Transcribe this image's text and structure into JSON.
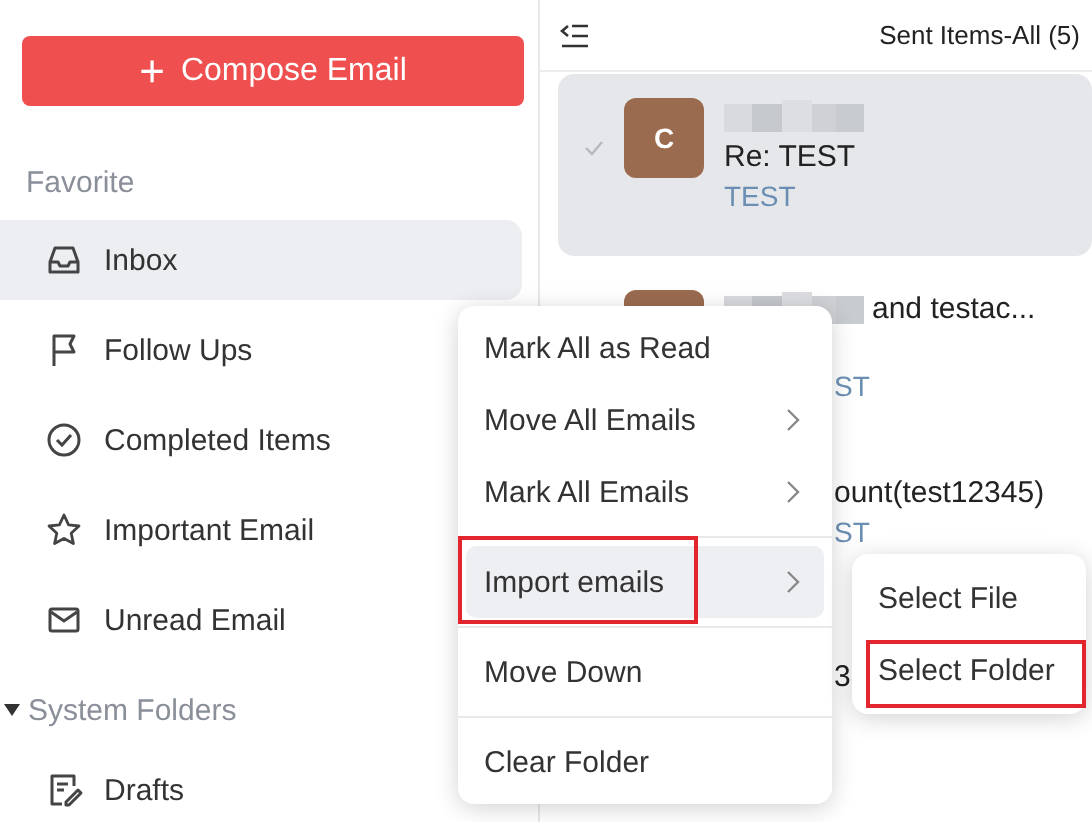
{
  "sidebar": {
    "compose_button": {
      "icon": "+",
      "label": "Compose Email"
    },
    "favorite_heading": "Favorite",
    "items": [
      {
        "label": "Inbox",
        "selected": true
      },
      {
        "label": "Follow Ups",
        "selected": false
      },
      {
        "label": "Completed Items",
        "selected": false
      },
      {
        "label": "Important Email",
        "selected": false
      },
      {
        "label": "Unread Email",
        "selected": false
      }
    ],
    "system_folders": {
      "label": "System Folders",
      "expanded": true,
      "items": [
        {
          "label": "Drafts",
          "selected": false
        }
      ]
    }
  },
  "mail_list": {
    "title": "Sent Items-All (5)",
    "mails": [
      {
        "kind": "full",
        "selected": true,
        "avatar_letter": "C",
        "name_blurred": true,
        "subject": "Re: TEST",
        "preview": "TEST"
      },
      {
        "kind": "partial",
        "selected": false,
        "name_blurred": true,
        "name": "and testac...",
        "preview": "ST"
      },
      {
        "kind": "covered",
        "selected": false,
        "name": "ount(test12345)",
        "preview": "ST"
      },
      {
        "kind": "edge",
        "selected": false,
        "name": "3"
      }
    ]
  },
  "context_menu": {
    "items": [
      {
        "label": "Mark All as Read",
        "submenu": false,
        "selected": false,
        "highlighted": false,
        "divider_before": false
      },
      {
        "label": "Move All Emails",
        "submenu": true,
        "selected": false,
        "highlighted": false,
        "divider_before": false
      },
      {
        "label": "Mark All Emails",
        "submenu": true,
        "selected": false,
        "highlighted": false,
        "divider_before": false
      },
      {
        "label": "Import emails",
        "submenu": true,
        "selected": true,
        "highlighted": true,
        "divider_before": true
      },
      {
        "label": "Move Down",
        "submenu": false,
        "selected": false,
        "highlighted": false,
        "divider_before": true
      },
      {
        "label": "Clear Folder",
        "submenu": false,
        "selected": false,
        "highlighted": false,
        "divider_before": true
      }
    ]
  },
  "submenu": {
    "items": [
      {
        "label": "Select File",
        "highlighted": false
      },
      {
        "label": "Select Folder",
        "highlighted": true
      }
    ]
  }
}
